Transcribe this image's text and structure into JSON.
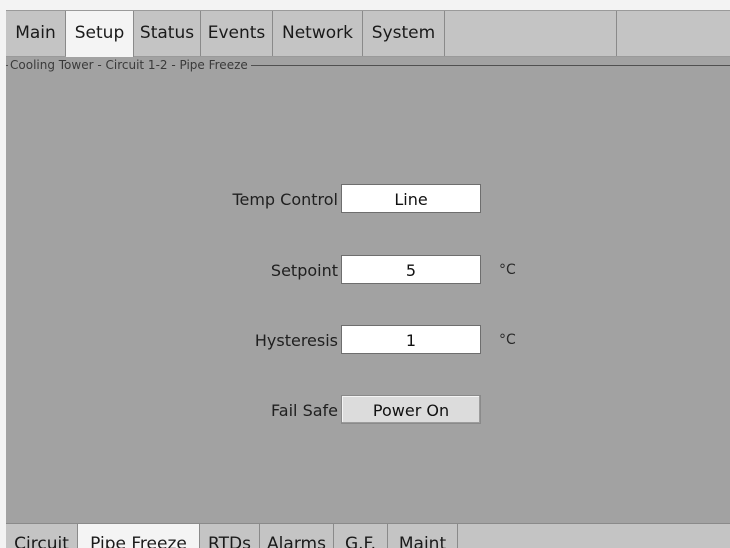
{
  "top_tabs": [
    {
      "label": "Main"
    },
    {
      "label": "Setup"
    },
    {
      "label": "Status"
    },
    {
      "label": "Events"
    },
    {
      "label": "Network"
    },
    {
      "label": "System"
    }
  ],
  "top_tab_active": "Setup",
  "group": {
    "title": "Cooling Tower - Circuit 1-2 - Pipe Freeze"
  },
  "fields": {
    "temp_control": {
      "label": "Temp Control",
      "value": "Line"
    },
    "setpoint": {
      "label": "Setpoint",
      "value": "5",
      "unit": "°C"
    },
    "hysteresis": {
      "label": "Hysteresis",
      "value": "1",
      "unit": "°C"
    },
    "fail_safe": {
      "label": "Fail Safe",
      "value": "Power On"
    }
  },
  "bottom_tabs": [
    {
      "label": "Circuit"
    },
    {
      "label": "Pipe Freeze"
    },
    {
      "label": "RTDs"
    },
    {
      "label": "Alarms"
    },
    {
      "label": "G.F."
    },
    {
      "label": "Maint"
    }
  ],
  "bottom_tab_active": "Pipe Freeze",
  "colors": {
    "panel_bg": "#a2a2a2",
    "tab_bg": "#c4c4c4",
    "active_tab_bg": "#f4f4f4",
    "field_bg": "#ffffff"
  }
}
